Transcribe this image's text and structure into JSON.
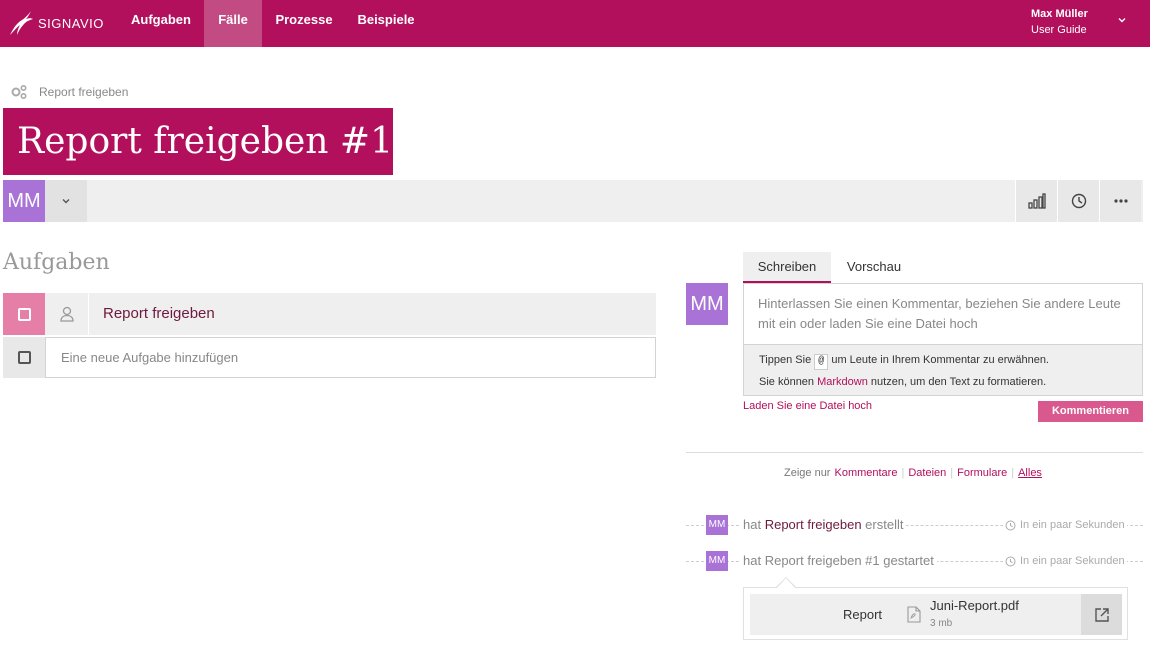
{
  "brand": {
    "name": "SIGNAVIO",
    "accent": "#b20f5c"
  },
  "nav": {
    "items": [
      {
        "label": "Aufgaben"
      },
      {
        "label": "Fälle"
      },
      {
        "label": "Prozesse"
      },
      {
        "label": "Beispiele"
      }
    ],
    "active": "Fälle"
  },
  "user": {
    "name": "Max Müller",
    "subtitle": "User Guide"
  },
  "breadcrumb": {
    "label": "Report freigeben"
  },
  "page_title": "Report freigeben #1",
  "toolbar": {
    "avatar_initials": "MM",
    "icons": [
      "bar-chart-icon",
      "clock-icon",
      "more-icon"
    ]
  },
  "tasks": {
    "heading": "Aufgaben",
    "items": [
      {
        "label": "Report freigeben"
      }
    ],
    "new_placeholder": "Eine neue Aufgabe hinzufügen"
  },
  "comment": {
    "avatar_initials": "MM",
    "tabs": [
      "Schreiben",
      "Vorschau"
    ],
    "active_tab": "Schreiben",
    "placeholder": "Hinterlassen Sie einen Kommentar, beziehen Sie andere Leute mit ein oder laden Sie eine Datei hoch",
    "hint1_prefix": "Tippen Sie",
    "hint1_code": "@",
    "hint1_suffix": "um Leute in Ihrem Kommentar zu erwähnen.",
    "hint2_prefix": "Sie können",
    "hint2_link": "Markdown",
    "hint2_suffix": "nutzen, um den Text zu formatieren.",
    "upload_link": "Laden Sie eine Datei hoch",
    "submit": "Kommentieren"
  },
  "filter": {
    "prefix": "Zeige nur",
    "options": [
      "Kommentare",
      "Dateien",
      "Formulare",
      "Alles"
    ],
    "active": "Alles"
  },
  "activity": [
    {
      "initials": "MM",
      "prefix": "hat",
      "link": "Report freigeben",
      "suffix": "erstellt",
      "time": "In ein paar Sekunden"
    },
    {
      "initials": "MM",
      "prefix": "hat",
      "link": "Report freigeben #1",
      "suffix": "gestartet",
      "time": "In ein paar Sekunden"
    }
  ],
  "attachment": {
    "label": "Report",
    "file_name": "Juni-Report.pdf",
    "file_size": "3 mb"
  }
}
